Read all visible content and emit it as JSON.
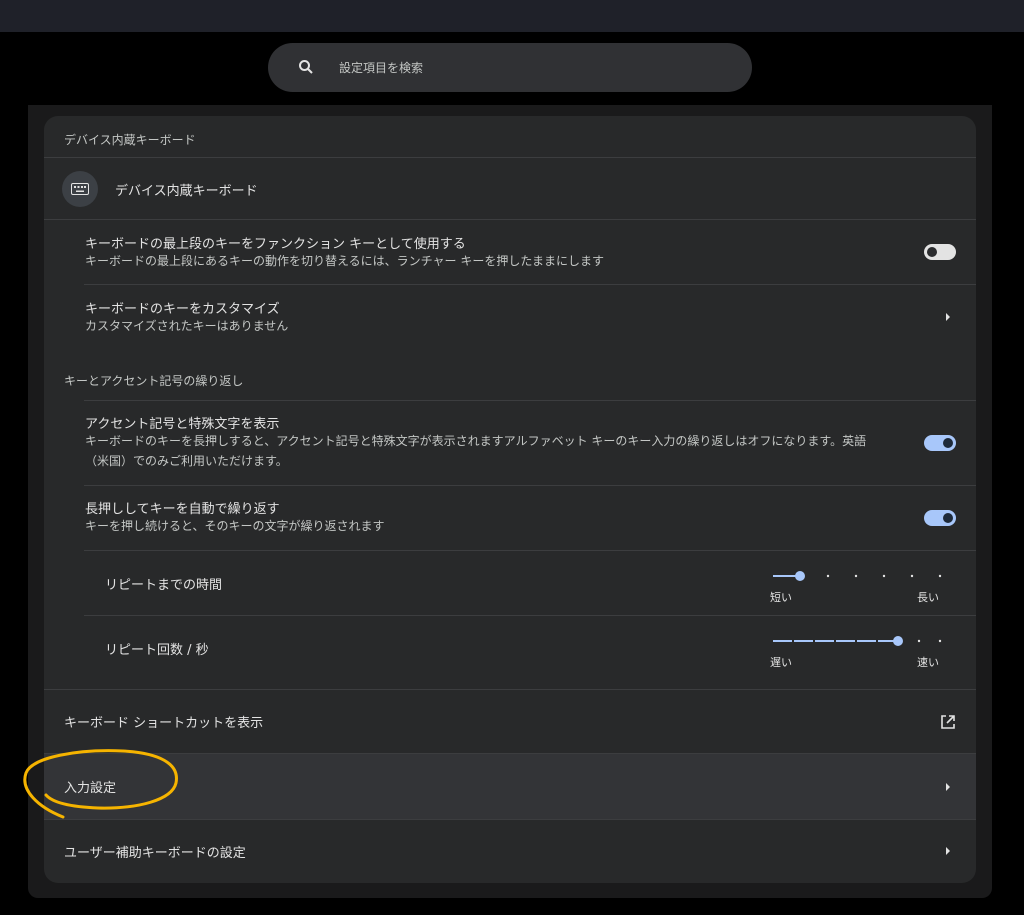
{
  "search": {
    "placeholder": "設定項目を検索"
  },
  "builtin_keyboard": {
    "section_title": "デバイス内蔵キーボード",
    "device_name": "デバイス内蔵キーボード",
    "top_row": {
      "title": "キーボードの最上段のキーをファンクション キーとして使用する",
      "subtitle": "キーボードの最上段にあるキーの動作を切り替えるには、ランチャー キーを押したままにします",
      "enabled": false
    },
    "customize": {
      "title": "キーボードのキーをカスタマイズ",
      "subtitle": "カスタマイズされたキーはありません"
    }
  },
  "repeat_section": {
    "title": "キーとアクセント記号の繰り返し",
    "accent": {
      "title": "アクセント記号と特殊文字を表示",
      "subtitle": "キーボードのキーを長押しすると、アクセント記号と特殊文字が表示されますアルファベット キーのキー入力の繰り返しはオフになります。英語（米国）でのみご利用いただけます。",
      "enabled": true
    },
    "auto_repeat": {
      "title": "長押ししてキーを自動で繰り返す",
      "subtitle": "キーを押し続けると、そのキーの文字が繰り返されます",
      "enabled": true
    },
    "delay": {
      "title": "リピートまでの時間",
      "min_label": "短い",
      "max_label": "長い",
      "position": 2,
      "steps": 7
    },
    "rate": {
      "title": "リピート回数 / 秒",
      "min_label": "遅い",
      "max_label": "速い",
      "position": 7,
      "steps": 9
    }
  },
  "shortcuts": {
    "title": "キーボード ショートカットを表示"
  },
  "input_settings": {
    "title": "入力設定"
  },
  "a11y_keyboard": {
    "title": "ユーザー補助キーボードの設定"
  },
  "colors": {
    "accent": "#a8c7fa",
    "annotation": "#f6b400"
  }
}
